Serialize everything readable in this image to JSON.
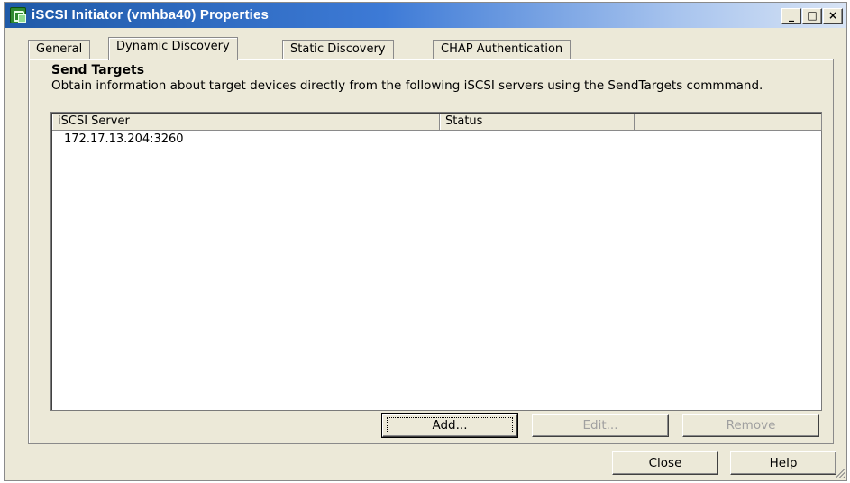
{
  "window": {
    "title": "iSCSI Initiator (vmhba40) Properties",
    "controls": {
      "minimize": "_",
      "maximize": "□",
      "close": "×"
    }
  },
  "tabs": [
    {
      "label": "General",
      "active": false
    },
    {
      "label": "Dynamic Discovery",
      "active": true
    },
    {
      "label": "Static Discovery",
      "active": false
    },
    {
      "label": "CHAP Authentication",
      "active": false
    }
  ],
  "send_targets": {
    "title": "Send Targets",
    "description": "Obtain information about target devices directly from the following iSCSI servers using the SendTargets commmand."
  },
  "server_list": {
    "columns": [
      "iSCSI Server",
      "Status",
      ""
    ],
    "rows": [
      {
        "server": "172.17.13.204:3260",
        "status": ""
      }
    ]
  },
  "list_buttons": {
    "add": "Add...",
    "edit": "Edit...",
    "remove": "Remove"
  },
  "footer_buttons": {
    "close": "Close",
    "help": "Help"
  },
  "colors": {
    "title_bar_start": "#1f5aa8",
    "title_bar_end": "#d8e4f5",
    "dialog_face": "#ece9d8",
    "disabled_text": "#a0a0a0"
  }
}
